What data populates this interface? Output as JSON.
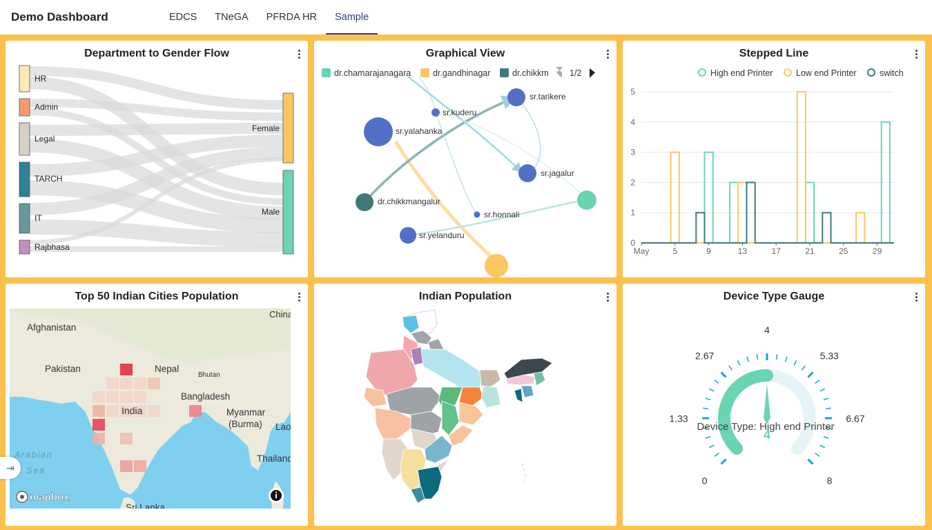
{
  "app": {
    "title": "Demo Dashboard",
    "tabs": [
      {
        "label": "EDCS",
        "active": false
      },
      {
        "label": "TNeGA",
        "active": false
      },
      {
        "label": "PFRDA HR",
        "active": false
      },
      {
        "label": "Sample",
        "active": true
      }
    ]
  },
  "cards": {
    "sankey": {
      "title": "Department to Gender Flow",
      "sources": [
        {
          "label": "HR",
          "color": "#fde9b4"
        },
        {
          "label": "Admin",
          "color": "#f79a72"
        },
        {
          "label": "Legal",
          "color": "#d8cfc6"
        },
        {
          "label": "TARCH",
          "color": "#2e8197"
        },
        {
          "label": "IT",
          "color": "#67999a"
        },
        {
          "label": "Rajbhasa",
          "color": "#c190be"
        }
      ],
      "targets": [
        {
          "label": "Female",
          "color": "#fcc660"
        },
        {
          "label": "Male",
          "color": "#6fd3b3"
        }
      ]
    },
    "graph": {
      "title": "Graphical View",
      "legend": [
        {
          "label": "dr.chamarajanagara",
          "color": "#6ad5b0"
        },
        {
          "label": "dr.gandhinagar",
          "color": "#fcc660"
        },
        {
          "label": "dr.chikkm",
          "color": "#3d7a78"
        }
      ],
      "pager": "1/2",
      "nodes": [
        {
          "label": "sr.kuderu",
          "color": "#5470c6"
        },
        {
          "label": "sr.tarikere",
          "color": "#5470c6"
        },
        {
          "label": "sr.yalahanka",
          "color": "#5470c6"
        },
        {
          "label": "sr.jagalur",
          "color": "#5470c6"
        },
        {
          "label": "dr.chikkmangalur",
          "color": "#3d7a78"
        },
        {
          "label": "sr.honnali",
          "color": "#5470c6"
        },
        {
          "label": "sr.yelanduru",
          "color": "#5470c6"
        },
        {
          "label": "",
          "color": "#6ad5b0"
        }
      ]
    },
    "stepped": {
      "title": "Stepped Line",
      "yticks": [
        "0",
        "1",
        "2",
        "3",
        "4",
        "5"
      ],
      "xticks": [
        "May",
        "5",
        "9",
        "13",
        "17",
        "21",
        "25",
        "29"
      ]
    },
    "cities": {
      "title": "Top 50 Indian Cities Population",
      "places": [
        "China",
        "Afghanistan",
        "Pakistan",
        "Nepal",
        "Bhutan",
        "India",
        "Bangladesh",
        "Myanmar",
        "(Burma)",
        "Lao",
        "Thailand",
        "Arabian",
        "Sea",
        "Sri Lanka"
      ],
      "attribution": "mapbox",
      "info_icon": "info-icon"
    },
    "population": {
      "title": "Indian Population"
    },
    "gauge": {
      "title": "Device Type Gauge",
      "ticks": [
        "0",
        "1.33",
        "2.67",
        "4",
        "5.33",
        "6.67",
        "8"
      ],
      "detail": "Device Type: High end Printer",
      "value": "4",
      "value_num": 4,
      "max": 8
    }
  },
  "chart_data": [
    {
      "type": "line",
      "step": true,
      "title": "Stepped Line",
      "x": [
        "May 1",
        "May 2",
        "May 3",
        "May 4",
        "May 5",
        "May 6",
        "May 7",
        "May 8",
        "May 9",
        "May 10",
        "May 11",
        "May 12",
        "May 13",
        "May 14",
        "May 15",
        "May 16",
        "May 17",
        "May 18",
        "May 19",
        "May 20",
        "May 21",
        "May 22",
        "May 23",
        "May 24",
        "May 25",
        "May 26",
        "May 27",
        "May 28",
        "May 29",
        "May 30",
        "May 31"
      ],
      "ylim": [
        0,
        5
      ],
      "legend_position": "top-right",
      "series": [
        {
          "name": "High end Printer",
          "color": "#6ad5b0",
          "values": [
            0,
            0,
            0,
            0,
            0,
            0,
            0,
            0,
            3,
            0,
            0,
            2,
            2,
            0,
            0,
            0,
            0,
            0,
            0,
            0,
            2,
            0,
            0,
            0,
            0,
            0,
            0,
            0,
            0,
            4,
            0
          ]
        },
        {
          "name": "Low end Printer",
          "color": "#fcc660",
          "values": [
            0,
            0,
            0,
            0,
            3,
            0,
            0,
            0,
            0,
            0,
            0,
            0,
            2,
            0,
            0,
            0,
            0,
            0,
            0,
            5,
            0,
            0,
            0,
            0,
            0,
            0,
            1,
            0,
            0,
            0,
            0
          ]
        },
        {
          "name": "switch",
          "color": "#3d7a78",
          "values": [
            0,
            0,
            0,
            0,
            0,
            0,
            0,
            1,
            0,
            0,
            0,
            0,
            0,
            2,
            0,
            0,
            0,
            0,
            0,
            0,
            0,
            0,
            1,
            0,
            0,
            0,
            0,
            0,
            0,
            0,
            0
          ]
        }
      ]
    },
    {
      "type": "gauge",
      "title": "Device Type Gauge",
      "min": 0,
      "max": 8,
      "value": 4,
      "label": "Device Type: High end Printer"
    }
  ]
}
